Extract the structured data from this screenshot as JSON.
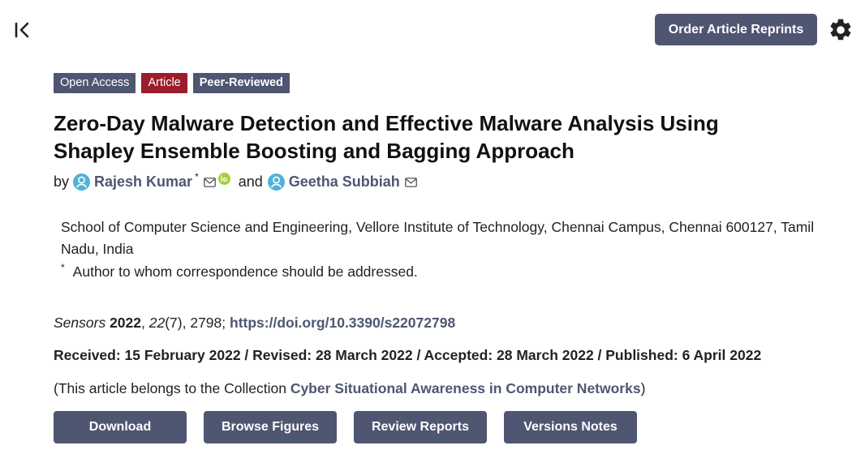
{
  "header": {
    "collapse_icon": "collapse-left-icon",
    "order_reprints_label": "Order Article Reprints",
    "settings_icon": "gear-icon"
  },
  "badges": {
    "open_access": "Open Access",
    "article": "Article",
    "peer_reviewed": "Peer-Reviewed"
  },
  "article": {
    "title": "Zero-Day Malware Detection and Effective Malware Analysis Using Shapley Ensemble Boosting and Bagging Approach",
    "by": "by",
    "authors": [
      {
        "name": "Rajesh Kumar",
        "marker": "*"
      },
      {
        "name": "Geetha Subbiah"
      }
    ],
    "and": "and",
    "affiliation": "School of Computer Science and Engineering, Vellore Institute of Technology, Chennai Campus, Chennai 600127, Tamil Nadu, India",
    "correspondence_marker": "*",
    "correspondence": "Author to whom correspondence should be addressed."
  },
  "citation": {
    "journal": "Sensors",
    "year": "2022",
    "volume": "22",
    "issue_pages": "(7), 2798;",
    "doi": "https://doi.org/10.3390/s22072798"
  },
  "dates": "Received: 15 February 2022 / Revised: 28 March 2022 / Accepted: 28 March 2022 / Published: 6 April 2022",
  "collection": {
    "prefix": "(This article belongs to the Collection ",
    "link": "Cyber Situational Awareness in Computer Networks",
    "suffix": ")"
  },
  "actions": {
    "download": "Download",
    "browse_figures": "Browse Figures",
    "review_reports": "Review Reports",
    "versions_notes": "Versions Notes"
  },
  "colors": {
    "primary": "#4f5671",
    "article_badge": "#9b1c2b",
    "author_icon": "#4fb3d9",
    "orcid": "#a6ce39"
  }
}
